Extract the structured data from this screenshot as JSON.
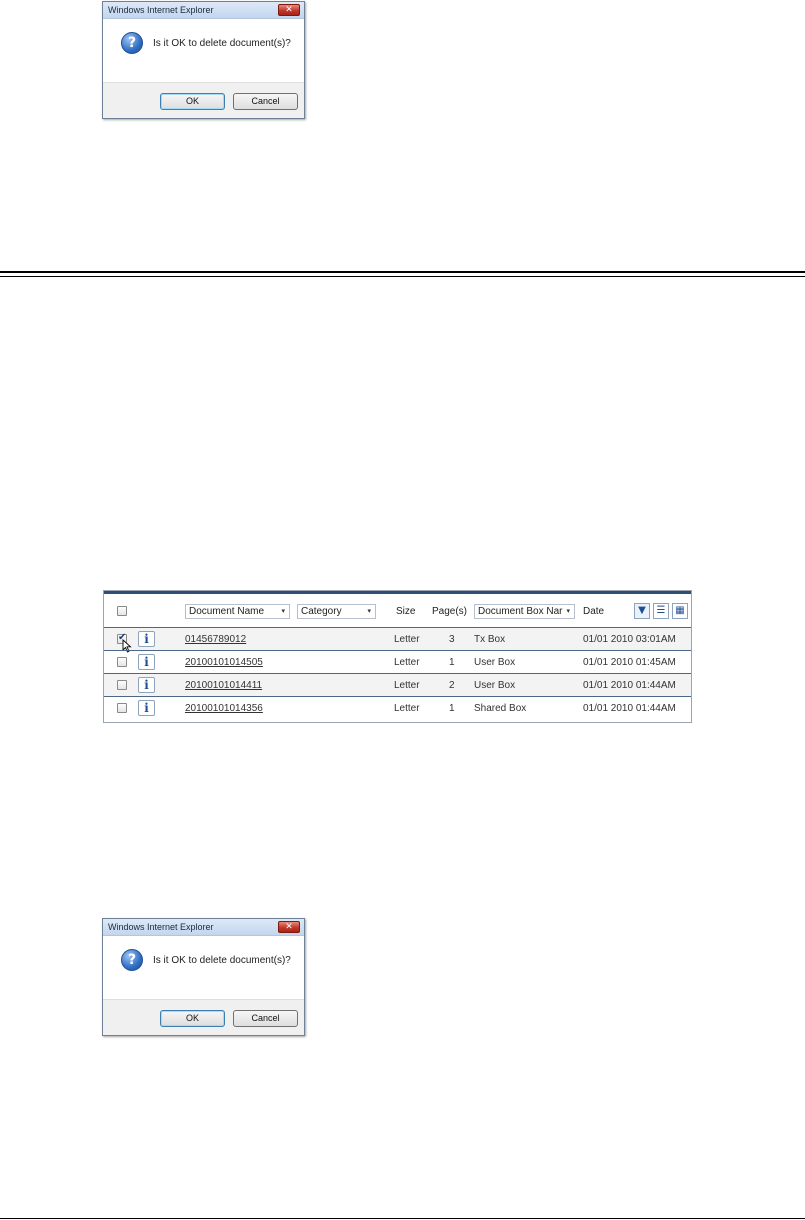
{
  "dialog": {
    "title": "Windows Internet Explorer",
    "close_glyph": "✕",
    "icon_glyph": "?",
    "message": "Is it OK to delete document(s)?",
    "ok_label": "OK",
    "cancel_label": "Cancel"
  },
  "doc_list": {
    "header": {
      "document_name": "Document Name",
      "category": "Category",
      "size": "Size",
      "pages": "Page(s)",
      "document_box": "Document Box Nar",
      "date": "Date",
      "dropdown_glyph": "▾",
      "sort_glyph": "▼",
      "list_view_glyph": "☰",
      "thumb_view_glyph": "▦"
    },
    "info_glyph": "i",
    "rows": [
      {
        "name": "01456789012",
        "size": "Letter",
        "pages": "3",
        "box": "Tx Box",
        "date": "01/01 2010 03:01AM",
        "checked": true
      },
      {
        "name": "20100101014505",
        "size": "Letter",
        "pages": "1",
        "box": "User Box",
        "date": "01/01 2010 01:45AM",
        "checked": false
      },
      {
        "name": "20100101014411",
        "size": "Letter",
        "pages": "2",
        "box": "User Box",
        "date": "01/01 2010 01:44AM",
        "checked": false
      },
      {
        "name": "20100101014356",
        "size": "Letter",
        "pages": "1",
        "box": "Shared Box",
        "date": "01/01 2010 01:44AM",
        "checked": false
      }
    ]
  },
  "colors": {
    "panel_bar": "#2f4e73",
    "row_divider": "#4d6686",
    "dialog_titlebar": "#c3d6ee",
    "close_button": "#c0392b"
  }
}
